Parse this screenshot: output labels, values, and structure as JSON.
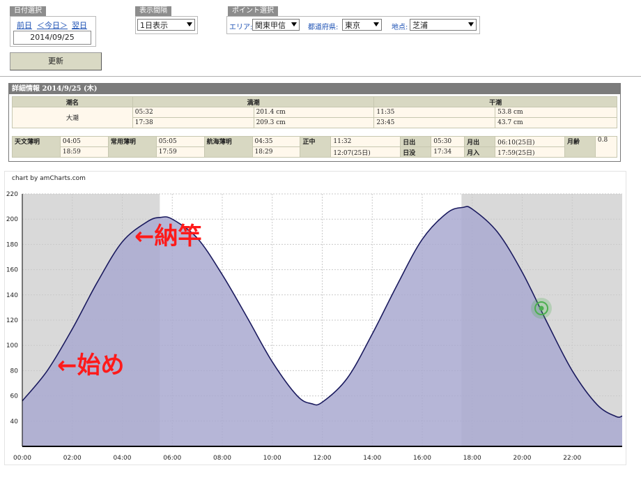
{
  "date_select": {
    "label": "日付選択",
    "prev": "前日",
    "today": "＜今日＞",
    "next": "翌日",
    "date": "2014/09/25",
    "update_button": "更新"
  },
  "interval_select": {
    "label": "表示間隔",
    "value": "1日表示"
  },
  "point_select": {
    "label": "ポイント選択",
    "area_label": "エリア:",
    "area_value": "関東甲信",
    "pref_label": "都道府県:",
    "pref_value": "東京",
    "place_label": "地点:",
    "place_value": "芝浦"
  },
  "detail": {
    "header": "詳細情報  2014/9/25 (木)",
    "col_tide_name": "潮名",
    "col_high": "満潮",
    "col_low": "干潮",
    "tide_name": "大潮",
    "high_rows": [
      {
        "time": "05:32",
        "level": "201.4 cm"
      },
      {
        "time": "17:38",
        "level": "209.3 cm"
      }
    ],
    "low_rows": [
      {
        "time": "11:35",
        "level": "53.8 cm"
      },
      {
        "time": "23:45",
        "level": "43.7 cm"
      }
    ],
    "astro_label": "天文薄明",
    "astro": [
      "04:05",
      "18:59"
    ],
    "civil_label": "常用薄明",
    "civil": [
      "05:05",
      "17:59"
    ],
    "nautical_label": "航海薄明",
    "nautical": [
      "04:35",
      "18:29"
    ],
    "transit_label": "正中",
    "transit": [
      "11:32",
      "12:07(25日)"
    ],
    "sunrise_label": "日出",
    "sunrise": "05:30",
    "sunset_label": "日没",
    "sunset": "17:34",
    "moonrise_label": "月出",
    "moonrise": "06:10(25日)",
    "moonset_label": "月入",
    "moonset": "17:59(25日)",
    "moonage_label": "月齢",
    "moonage": "0.8"
  },
  "chart_credit": "chart by amCharts.com",
  "annotations": {
    "start": "←始め",
    "end": "←納竿"
  },
  "colors": {
    "night_shade": "#d9d9d9",
    "area_fill": "#a9a9d0",
    "line": "#1a1a5e",
    "annotation": "#ff1a1a",
    "cursor": "#4caf50"
  },
  "chart_data": {
    "type": "area",
    "title": "",
    "xlabel": "",
    "ylabel": "",
    "ylim": [
      20,
      220
    ],
    "xlim_hours": [
      0,
      24
    ],
    "y_ticks": [
      40,
      60,
      80,
      100,
      120,
      140,
      160,
      180,
      200,
      220
    ],
    "x_ticks": [
      "00:00",
      "02:00",
      "04:00",
      "06:00",
      "08:00",
      "10:00",
      "12:00",
      "14:00",
      "16:00",
      "18:00",
      "20:00",
      "22:00"
    ],
    "x_tick_hours": [
      0,
      2,
      4,
      6,
      8,
      10,
      12,
      14,
      16,
      18,
      20,
      22
    ],
    "night_ranges_hours": [
      [
        0,
        5.5
      ],
      [
        17.57,
        24
      ]
    ],
    "series": [
      {
        "x_hours": [
          0,
          1,
          2,
          3,
          4,
          5,
          5.53,
          6,
          7,
          8,
          9,
          10,
          11,
          11.58,
          12,
          13,
          14,
          15,
          16,
          17,
          17.63,
          18,
          19,
          20,
          21,
          22,
          23,
          23.75,
          24
        ],
        "values": [
          56,
          80,
          113,
          150,
          182,
          198,
          201.4,
          200,
          185,
          156,
          122,
          87,
          60,
          53.8,
          55,
          74,
          109,
          148,
          184,
          205,
          209.3,
          208,
          190,
          158,
          118,
          80,
          53,
          43.7,
          44
        ]
      }
    ]
  }
}
